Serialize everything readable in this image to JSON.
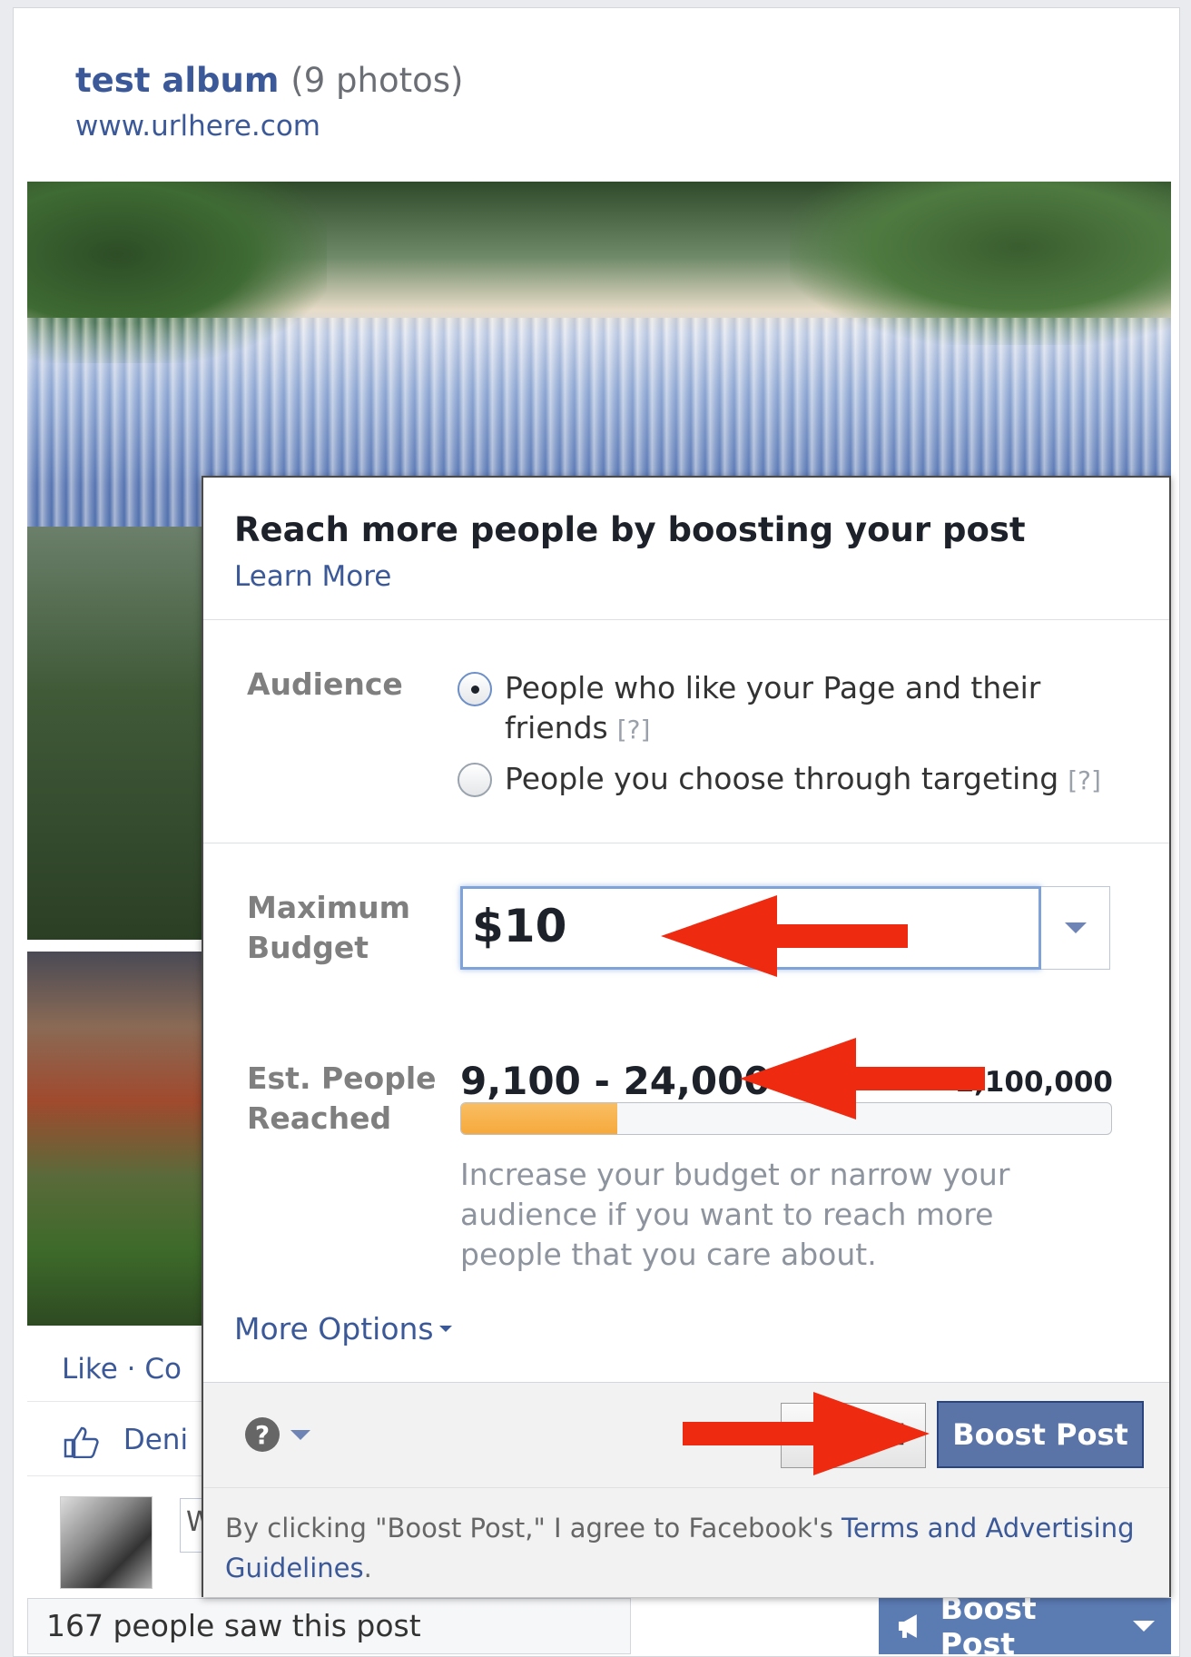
{
  "post": {
    "album_title": "test album",
    "photo_count": "(9 photos)",
    "url": "www.urlhere.com",
    "actions": "Like · Co",
    "likes": "Deni",
    "comment_prefix": "W",
    "people_saw": "167 people saw this post",
    "boost_button": "Boost Post"
  },
  "dialog": {
    "title": "Reach more people by boosting your post",
    "learn_more": "Learn More",
    "audience_label": "Audience",
    "audience_options": [
      {
        "label_line1": "People who like your Page and their",
        "label_line2": "friends",
        "help": "[?]",
        "selected": true
      },
      {
        "label_line1": "People you choose through targeting",
        "help": "[?]",
        "selected": false
      }
    ],
    "budget_label_1": "Maximum",
    "budget_label_2": "Budget",
    "budget_value": "$10",
    "reach_label_1": "Est. People",
    "reach_label_2": "Reached",
    "reach_range": "9,100 - 24,000",
    "reach_max": "1,100,000",
    "reach_fraction": 0.24,
    "reach_hint": "Increase your budget or narrow your audience if you want to reach more people that you care about.",
    "more_options": "More Options",
    "help_glyph": "?",
    "cancel_label": "Cancel",
    "boost_label": "Boost Post",
    "terms_prefix": "By clicking \"Boost Post,\" I agree to Facebook's ",
    "terms_link": "Terms and Advertising Guidelines",
    "terms_suffix": "."
  },
  "colors": {
    "link": "#3b5998",
    "boost_button": "#5b74a8",
    "reach_bar": "#f6a93c",
    "arrow": "#ee2a10"
  },
  "icons": [
    "thumbs-up-icon",
    "help-icon",
    "megaphone-icon",
    "chevron-down-icon",
    "red-arrow"
  ]
}
